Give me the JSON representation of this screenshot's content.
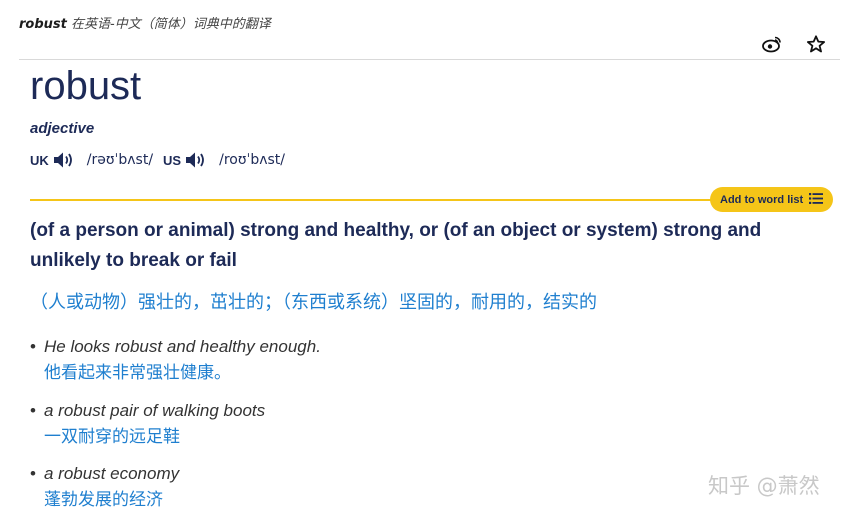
{
  "breadcrumb": {
    "word": "robust",
    "text": "在英语-中文（简体）词典中的翻译"
  },
  "toolbar": {
    "icons": [
      "weibo-icon",
      "star-icon"
    ]
  },
  "entry": {
    "headword": "robust",
    "part_of_speech": "adjective",
    "pronunciations": [
      {
        "region": "UK",
        "ipa": "/rəʊˈbʌst/"
      },
      {
        "region": "US",
        "ipa": "/roʊˈbʌst/"
      }
    ],
    "add_to_word_list_label": "Add to word list",
    "definition": "(of a person or animal) strong and healthy, or (of an object or system) strong and unlikely to break or fail",
    "translation": "（人或动物）强壮的，茁壮的；（东西或系统）坚固的，耐用的，结实的",
    "examples": [
      {
        "en": "He looks robust and healthy enough.",
        "zh": "他看起来非常强壮健康。"
      },
      {
        "en": "a robust pair of walking boots",
        "zh": "一双耐穿的远足鞋"
      },
      {
        "en": "a robust economy",
        "zh": "蓬勃发展的经济"
      }
    ]
  },
  "watermark": "知乎 @萧然",
  "colors": {
    "navy": "#1d2a57",
    "accent_yellow": "#f5c518",
    "translation_blue": "#1f7fcf"
  }
}
